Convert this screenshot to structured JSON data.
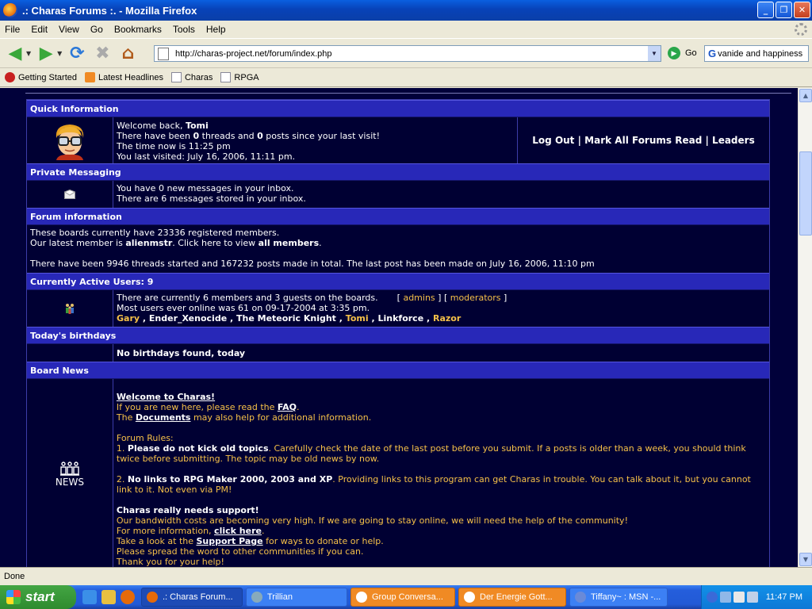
{
  "window": {
    "title": ".: Charas Forums :. - Mozilla Firefox"
  },
  "menu": [
    "File",
    "Edit",
    "View",
    "Go",
    "Bookmarks",
    "Tools",
    "Help"
  ],
  "nav": {
    "url": "http://charas-project.net/forum/index.php",
    "go_label": "Go",
    "search_value": "vanide and happiness"
  },
  "bookmarks": [
    "Getting Started",
    "Latest Headlines",
    "Charas",
    "RPGA"
  ],
  "quick_info": {
    "header": "Quick Information",
    "welcome_prefix": "Welcome back, ",
    "username": "Tomi",
    "threads_pre": "There have been ",
    "threads_count": "0",
    "threads_mid": " threads and ",
    "posts_count": "0",
    "posts_post": " posts since your last visit!",
    "time_now": "The time now is 11:25 pm",
    "last_visit": "You last visited: July 16, 2006, 11:11 pm.",
    "logout": "Log Out",
    "sep": " | ",
    "mark_read": "Mark All Forums Read",
    "leaders": "Leaders"
  },
  "pm": {
    "header": "Private Messaging",
    "line1": "You have 0 new messages in your inbox.",
    "line2": "There are 6 messages stored in your inbox."
  },
  "forum_info": {
    "header": "Forum information",
    "line1": "These boards currently have 23336 registered members.",
    "latest_pre": "Our latest member is ",
    "latest_member": "alienmstr",
    "latest_mid": ". Click here to view ",
    "all_members": "all members",
    "latest_end": ".",
    "line3": "There have been 9946 threads started and 167232 posts made in total. The last post has been made on July 16, 2006, 11:10 pm"
  },
  "active_users": {
    "header": "Currently Active Users: 9",
    "line1": "There are currently 6 members and 3 guests on the boards.",
    "admins": "admins",
    "moderators": "moderators",
    "line2": "Most users ever online was 61 on 09-17-2004 at 3:35 pm.",
    "users": [
      {
        "name": "Gary",
        "highlight": true
      },
      {
        "name": "Ender_Xenocide",
        "highlight": false
      },
      {
        "name": "The Meteoric Knight",
        "highlight": false
      },
      {
        "name": "Tomi",
        "highlight": true
      },
      {
        "name": "Linkforce",
        "highlight": false
      },
      {
        "name": "Razor",
        "highlight": true
      }
    ]
  },
  "birthdays": {
    "header": "Today's birthdays",
    "text": "No birthdays found, today"
  },
  "news": {
    "header": "Board News",
    "icon_label": "NEWS",
    "welcome_title": "Welcome to Charas!",
    "new_here_pre": "If you are new here, please read the ",
    "faq": "FAQ",
    "new_here_end": ".",
    "docs_pre": "The ",
    "documents": "Documents",
    "docs_post": " may also help for additional information.",
    "rules_title": "Forum Rules:",
    "rule1_num": "1. ",
    "rule1_bold": "Please do not kick old topics",
    "rule1_text": ". Carefully check the date of the last post before you submit. If a posts is older than a week, you should think twice before submitting. The topic may be old news by now.",
    "rule2_num": "2. ",
    "rule2_bold": "No links to RPG Maker 2000, 2003 and XP",
    "rule2_text": ". Providing links to this program can get Charas in trouble. You can talk about it, but you cannot link to it. Not even via PM!",
    "support_title": "Charas really needs support!",
    "support_line1": "Our bandwidth costs are becoming very high. If we are going to stay online, we will need the help of the community!",
    "more_info_pre": "For more information, ",
    "click_here": "click here",
    "more_info_end": ".",
    "take_look_pre": "Take a look at the ",
    "support_page": "Support Page",
    "take_look_post": " for ways to donate or help.",
    "spread": "Please spread the word to other communities if you can.",
    "thanks": "Thank you for your help!"
  },
  "status": {
    "text": "Done"
  },
  "taskbar": {
    "start": "start",
    "tasks": [
      ".: Charas Forum...",
      "Trillian",
      "Group Conversa...",
      "Der Energie Gott...",
      "Tiffany~ : MSN -..."
    ],
    "clock": "11:47 PM"
  }
}
